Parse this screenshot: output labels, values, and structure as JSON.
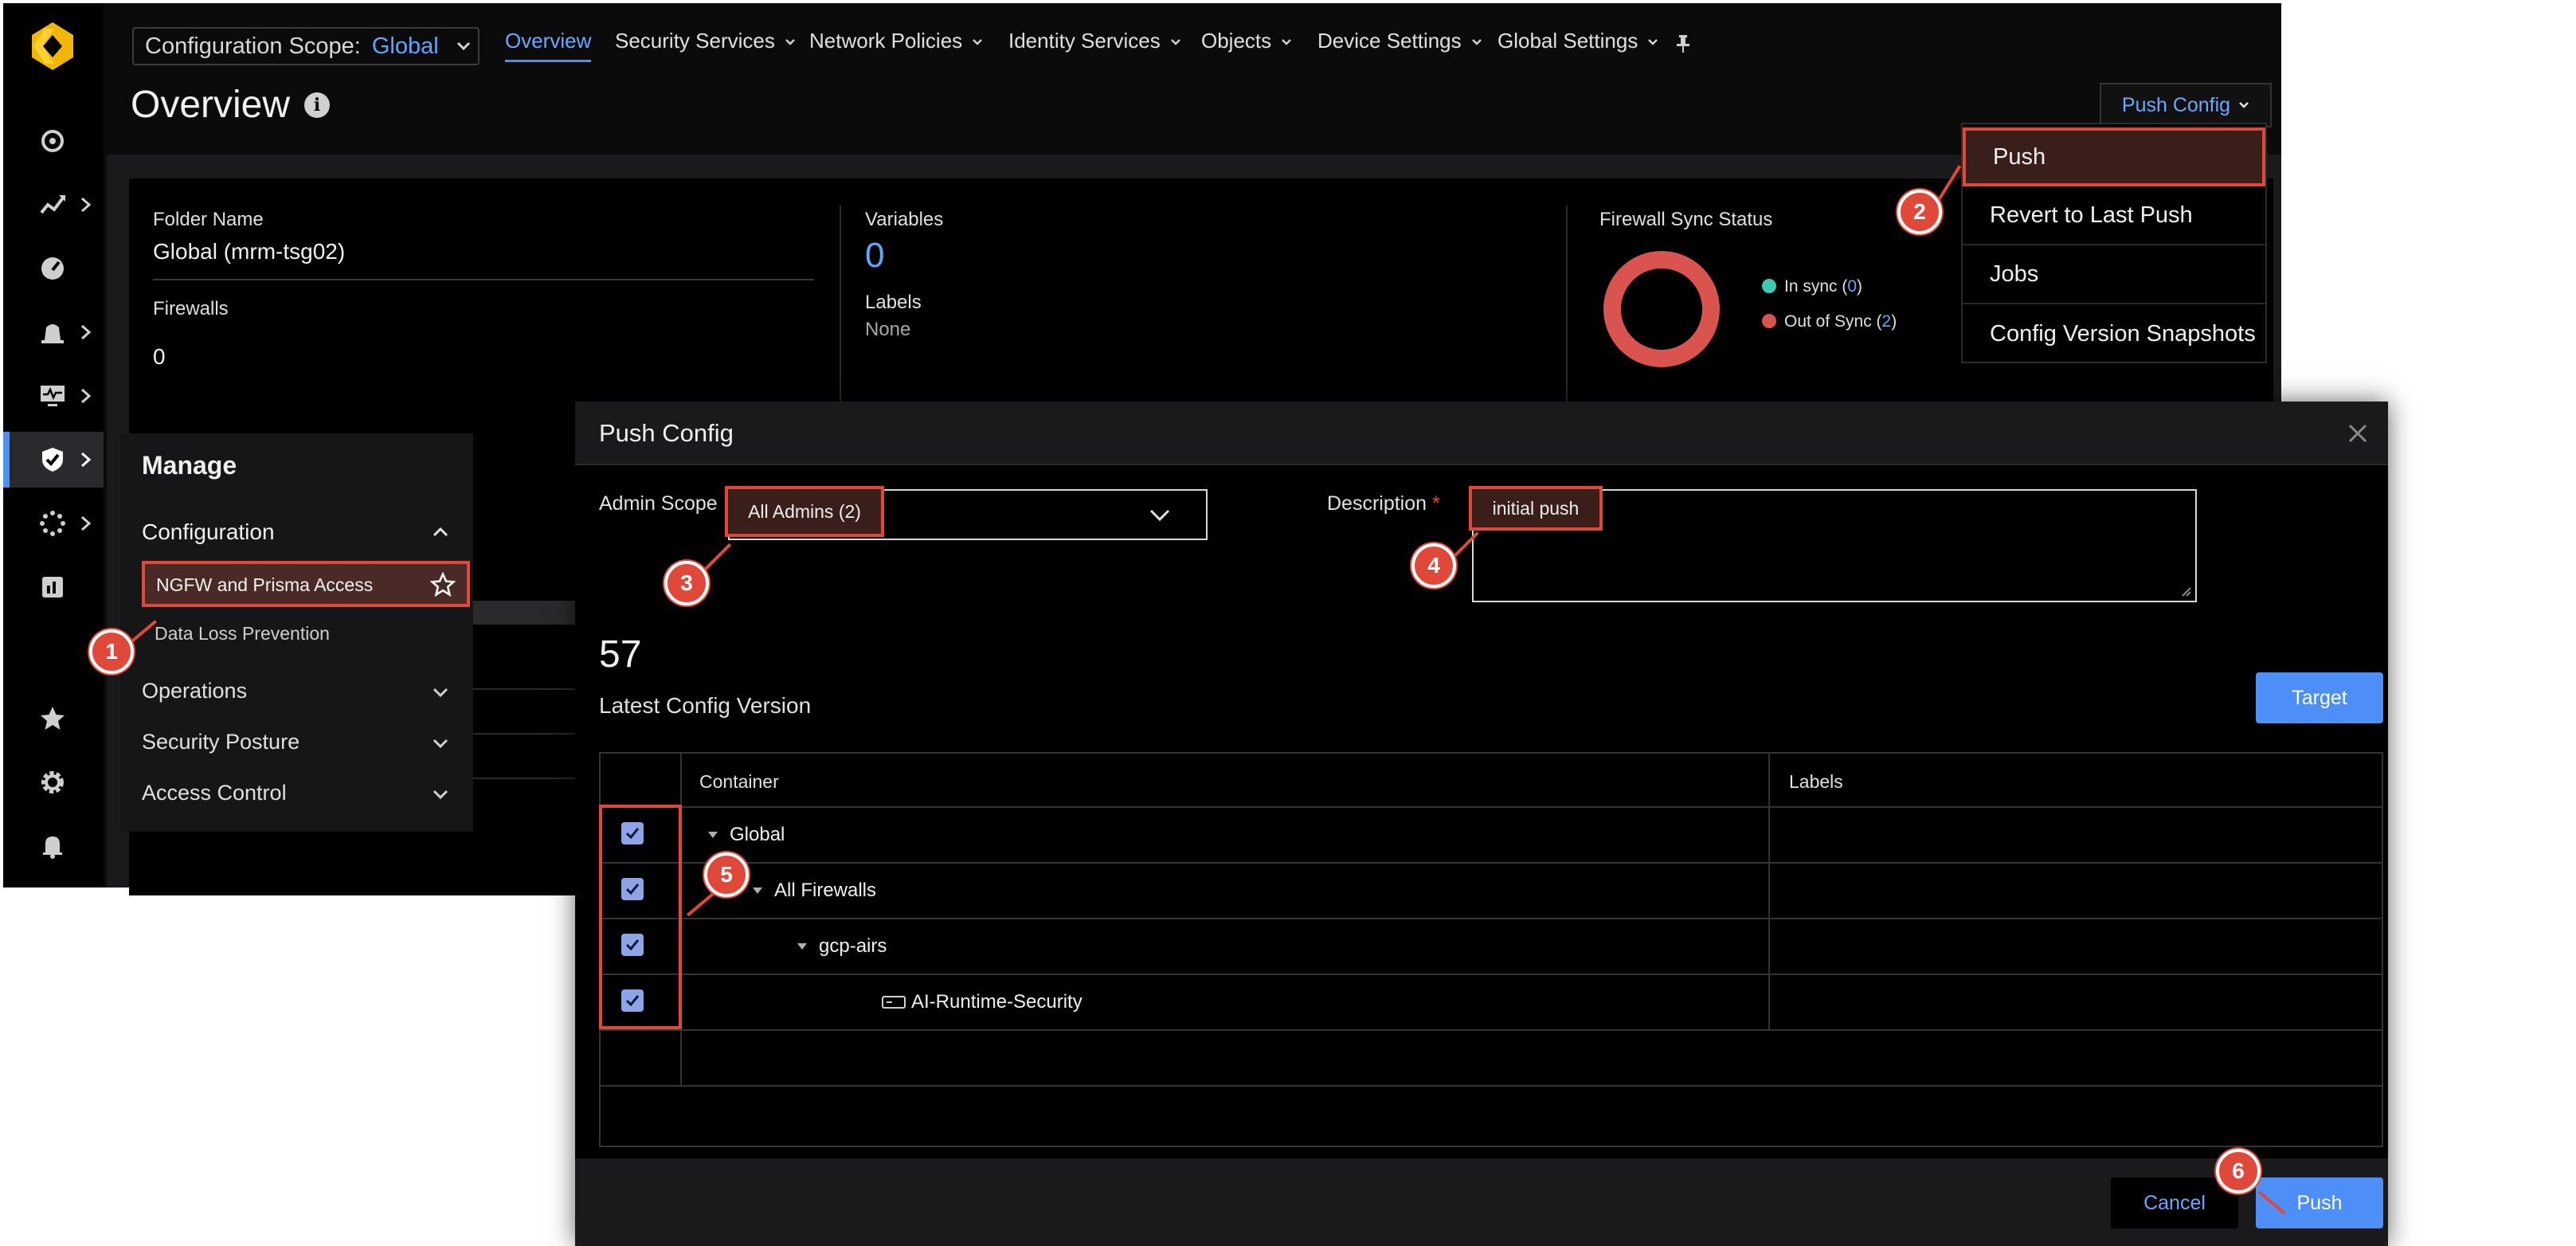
{
  "topbar": {
    "scope_label": "Configuration Scope:",
    "scope_value": "Global",
    "tabs": [
      {
        "label": "Overview"
      },
      {
        "label": "Security Services"
      },
      {
        "label": "Network Policies"
      },
      {
        "label": "Identity Services"
      },
      {
        "label": "Objects"
      },
      {
        "label": "Device Settings"
      },
      {
        "label": "Global Settings"
      }
    ]
  },
  "page": {
    "title": "Overview",
    "push_config_label": "Push Config"
  },
  "dropdown": {
    "items": [
      {
        "label": "Push"
      },
      {
        "label": "Revert to Last Push"
      },
      {
        "label": "Jobs"
      },
      {
        "label": "Config Version Snapshots"
      }
    ]
  },
  "overview": {
    "folder_name_label": "Folder Name",
    "folder_name_value": "Global (mrm-tsg02)",
    "firewalls_label": "Firewalls",
    "firewalls_value": "0",
    "variables_label": "Variables",
    "variables_value": "0",
    "labels_label": "Labels",
    "labels_value": "None",
    "sync_label": "Firewall Sync Status",
    "in_sync_label": "In sync (",
    "in_sync_count": "0",
    "out_sync_label": "Out of Sync (",
    "out_sync_count": "2",
    "close_paren": ")"
  },
  "manage": {
    "title": "Manage",
    "configuration": "Configuration",
    "items": [
      {
        "label": "NGFW and Prisma Access"
      },
      {
        "label": "Data Loss Prevention"
      }
    ],
    "operations": "Operations",
    "security_posture": "Security Posture",
    "access_control": "Access Control"
  },
  "modal": {
    "title": "Push Config",
    "admin_scope_label": "Admin Scope",
    "admin_scope_value": "All Admins (2)",
    "description_label": "Description",
    "required_mark": "*",
    "description_value": "initial push",
    "version_number": "57",
    "version_label": "Latest Config Version",
    "target_button": "Target",
    "columns": {
      "container": "Container",
      "labels": "Labels"
    },
    "rows": [
      {
        "name": "Global"
      },
      {
        "name": "All Firewalls"
      },
      {
        "name": "gcp-airs"
      },
      {
        "name": "AI-Runtime-Security"
      }
    ],
    "cancel_button": "Cancel",
    "push_button": "Push"
  },
  "callouts": [
    "1",
    "2",
    "3",
    "4",
    "5",
    "6"
  ],
  "colors": {
    "accent": "#4d8ff7",
    "highlight": "#e0483a",
    "in_sync": "#3fc9b0",
    "out_sync": "#d9534f",
    "background": "#0b0b0c"
  }
}
